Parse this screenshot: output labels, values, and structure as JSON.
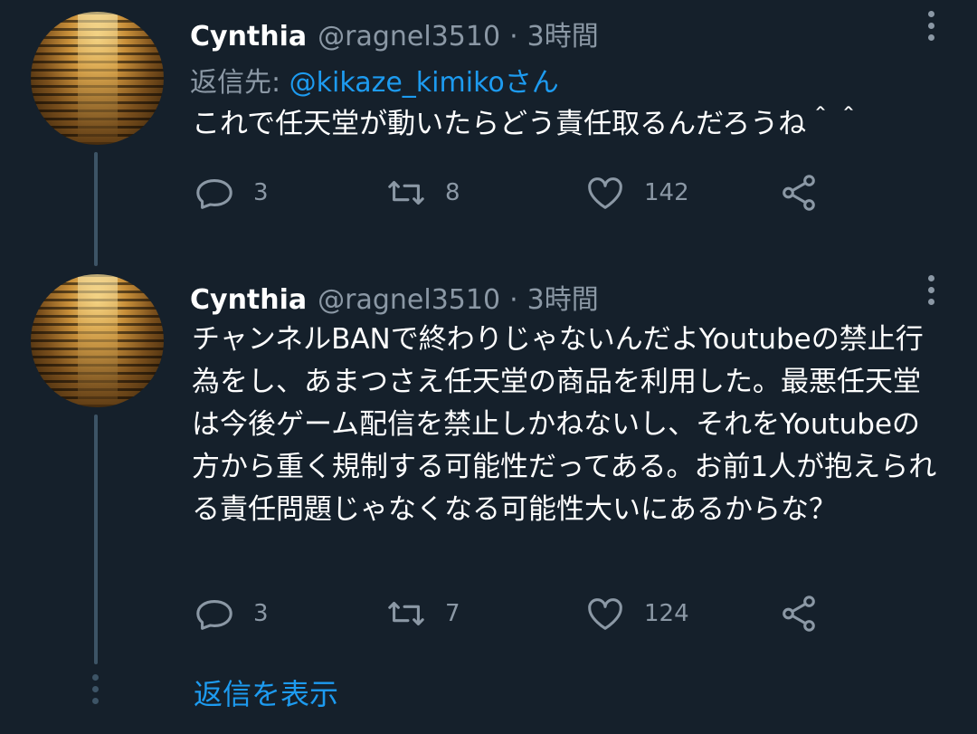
{
  "tweets": [
    {
      "name": "Cynthia",
      "handle": "@ragnel3510",
      "dot": "·",
      "time": "3時間",
      "reply_label": "返信先: ",
      "reply_mention": "@kikaze_kimiko",
      "reply_suffix": "さん",
      "text": "これで任天堂が動いたらどう責任取るんだろうね＾＾",
      "replies": "3",
      "retweets": "8",
      "likes": "142"
    },
    {
      "name": "Cynthia",
      "handle": "@ragnel3510",
      "dot": "·",
      "time": "3時間",
      "text": "チャンネルBANで終わりじゃないんだよYoutubeの禁止行為をし、あまつさえ任天堂の商品を利用した。最悪任天堂は今後ゲーム配信を禁止しかねないし、それをYoutubeの方から重く規制する可能性だってある。お前1人が抱えられる責任問題じゃなくなる可能性大いにあるからな？",
      "replies": "3",
      "retweets": "7",
      "likes": "124"
    }
  ],
  "show_replies": "返信を表示",
  "icons": [
    "reply-icon",
    "retweet-icon",
    "like-icon",
    "share-icon",
    "more-icon"
  ],
  "colors": {
    "background": "#15202b",
    "accent": "#1d9bf0",
    "muted": "#8b98a5",
    "thread": "#3d5466"
  }
}
